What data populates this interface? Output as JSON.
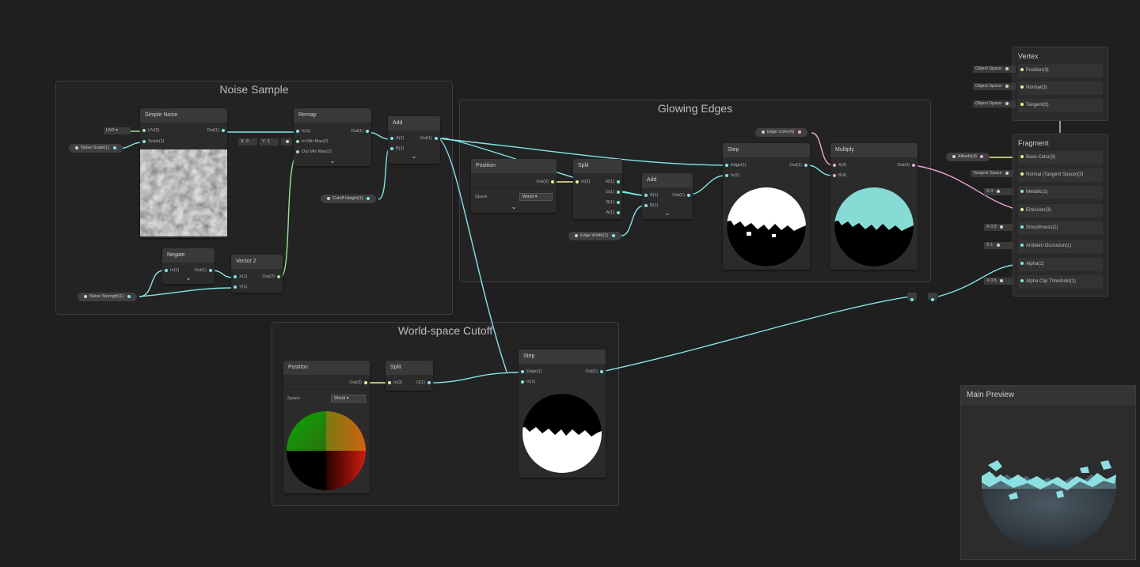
{
  "groups": {
    "noise": "Noise Sample",
    "glow": "Glowing Edges",
    "world": "World-space Cutoff"
  },
  "simple_noise": {
    "title": "Simple Noise",
    "in_uv": "UV(2)",
    "in_scale": "Scale(1)",
    "out": "Out(1)",
    "uv_dropdown": "UV0"
  },
  "noise_scale_prop": "Noise Scale(1)",
  "remap": {
    "title": "Remap",
    "in1": "In(1)",
    "in2": "In Min Max(2)",
    "in3": "Out Min Max(2)",
    "out": "Out(1)",
    "x_label": "X",
    "x_val": "0",
    "y_label": "Y",
    "y_val": "1"
  },
  "add1": {
    "title": "Add",
    "a": "A(1)",
    "b": "B(1)",
    "out": "Out(1)"
  },
  "cutoff_prop": "Cutoff Height(1)",
  "negate": {
    "title": "Negate",
    "in": "In(1)",
    "out": "Out(1)"
  },
  "vector2": {
    "title": "Vector 2",
    "x": "X(1)",
    "y": "Y(1)",
    "out": "Out(2)"
  },
  "noise_strength_prop": "Noise Strength(1)",
  "position1": {
    "title": "Position",
    "out": "Out(3)",
    "space_label": "Space",
    "space_value": "World"
  },
  "split1": {
    "title": "Split",
    "in": "In(3)",
    "r": "R(1)",
    "g": "G(1)",
    "b": "B(1)",
    "a": "A(1)"
  },
  "add2": {
    "title": "Add",
    "a": "A(1)",
    "b": "B(1)",
    "out": "Out(1)"
  },
  "edge_width_prop": "Edge Width(1)",
  "edge_color_prop": "Edge Color(4)",
  "step1": {
    "title": "Step",
    "edge": "Edge(1)",
    "in": "In(1)",
    "out": "Out(1)"
  },
  "multiply": {
    "title": "Multiply",
    "a": "A(4)",
    "b": "B(4)",
    "out": "Out(4)"
  },
  "position2": {
    "title": "Position",
    "out": "Out(3)",
    "space_label": "Space",
    "space_value": "World"
  },
  "split2": {
    "title": "Split",
    "in": "In(3)",
    "g": "G(1)"
  },
  "step2": {
    "title": "Step",
    "edge": "Edge(1)",
    "in": "In(1)",
    "out": "Out(1)"
  },
  "vertex": {
    "title": "Vertex",
    "rows": [
      {
        "chip": "Object Space",
        "label": "Position(3)"
      },
      {
        "chip": "Object Space",
        "label": "Normal(3)"
      },
      {
        "chip": "Object Space",
        "label": "Tangent(3)"
      }
    ]
  },
  "fragment": {
    "title": "Fragment",
    "rows": [
      {
        "chip": "",
        "label": "Base Color(3)"
      },
      {
        "chip": "Tangent Space",
        "label": "Normal (Tangent Space)(3)"
      },
      {
        "chip": "X  0",
        "label": "Metallic(1)"
      },
      {
        "chip": "",
        "label": "Emission(3)"
      },
      {
        "chip": "X  0.5",
        "label": "Smoothness(1)"
      },
      {
        "chip": "X  1",
        "label": "Ambient Occlusion(1)"
      },
      {
        "chip": "",
        "label": "Alpha(1)"
      },
      {
        "chip": "X  0.5",
        "label": "Alpha Clip Threshold(1)"
      }
    ]
  },
  "albedo_prop": "Albedo(4)",
  "main_preview": "Main Preview",
  "colors": {
    "wire_cyan": "#84e4e7",
    "wire_yellow": "#f0ef94",
    "wire_pink": "#e9a6d8",
    "wire_green": "#9be29b",
    "glow": "#86dcd4"
  }
}
